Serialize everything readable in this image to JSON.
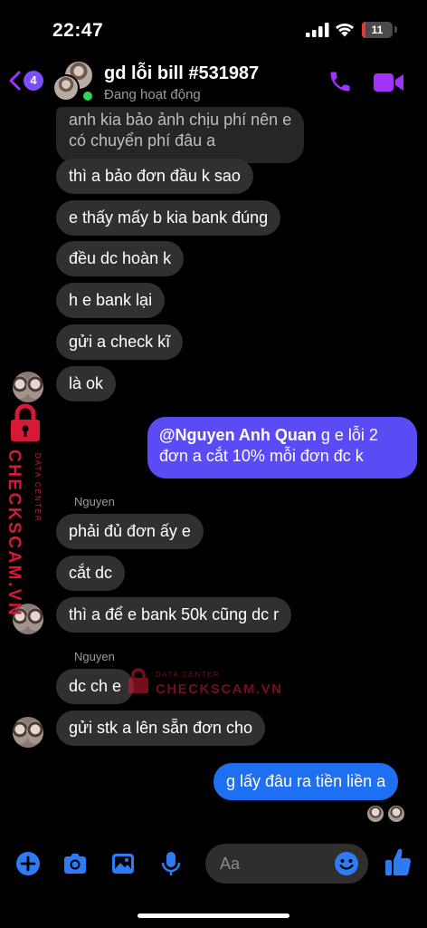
{
  "status_bar": {
    "time": "22:47",
    "battery": "11",
    "battery_level": 0.11
  },
  "header": {
    "back_badge": "4",
    "title": "gd lỗi bill #531987",
    "subtitle": "Đang hoạt động"
  },
  "messages": [
    {
      "type": "incoming",
      "text_lines": [
        "anh kia bảo ảnh chịu phí nên e",
        "có chuyển phí đâu a"
      ]
    },
    {
      "type": "incoming",
      "text": "thì a bảo đơn đầu k sao"
    },
    {
      "type": "incoming",
      "text": "e thấy mấy b kia bank đúng"
    },
    {
      "type": "incoming",
      "text": "đều dc hoàn k"
    },
    {
      "type": "incoming",
      "text": "h e bank lại"
    },
    {
      "type": "incoming",
      "text": "gửi a check kĩ"
    },
    {
      "type": "incoming",
      "text": "là ok"
    },
    {
      "type": "outgoing",
      "mention": "@Nguyen Anh Quan",
      "text_line1": " g e lỗi 2",
      "text_line2": "đơn a cắt 10% mỗi đơn đc k"
    },
    {
      "type": "sender",
      "text": "Nguyen"
    },
    {
      "type": "incoming",
      "text": "phải đủ đơn ấy e"
    },
    {
      "type": "incoming",
      "text": "cắt dc"
    },
    {
      "type": "incoming",
      "text": "thì a để e bank 50k cũng dc r"
    },
    {
      "type": "sender",
      "text": "Nguyen"
    },
    {
      "type": "incoming",
      "text": "dc ch e"
    },
    {
      "type": "incoming",
      "text": "gửi stk a lên sẵn đơn cho"
    },
    {
      "type": "outgoing",
      "text": "g lấy đâu ra tiền liền a"
    }
  ],
  "watermark": {
    "side_text": "CHECKSCAM.VN",
    "side_small": "DATA CENTER",
    "center_small": "DATA CENTER",
    "center_text": "CHECKSCAM.VN"
  },
  "composer": {
    "placeholder": "Aa"
  },
  "colors": {
    "accent": "#a033ff",
    "outgoing_bubble": "#5b4bf5",
    "outgoing_bubble_last": "#1f6ff2",
    "incoming_bubble": "#303030",
    "composer_icons": "#2d7cf6",
    "watermark": "#d41a35"
  },
  "icons": [
    "back-chevron-icon",
    "phone-icon",
    "video-camera-icon",
    "plus-icon",
    "camera-icon",
    "image-icon",
    "microphone-icon",
    "emoji-icon",
    "thumbs-up-icon"
  ]
}
